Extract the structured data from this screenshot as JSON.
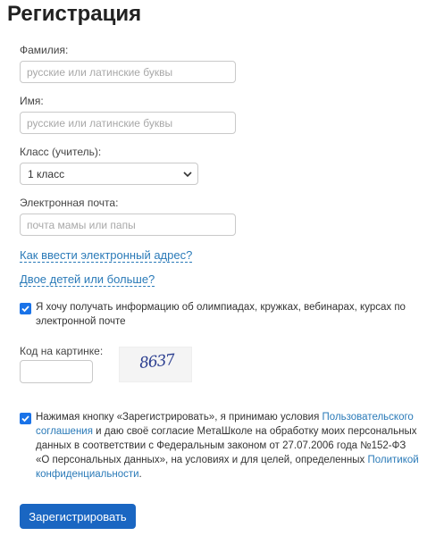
{
  "page": {
    "title": "Регистрация"
  },
  "form": {
    "surname": {
      "label": "Фамилия:",
      "value": "",
      "placeholder": "русские или латинские буквы"
    },
    "name": {
      "label": "Имя:",
      "value": "",
      "placeholder": "русские или латинские буквы"
    },
    "grade": {
      "label": "Класс (учитель):",
      "selected": "1 класс"
    },
    "email": {
      "label": "Электронная почта:",
      "value": "",
      "placeholder": "почта мамы или папы"
    },
    "links": {
      "how_to_email": "Как ввести электронный адрес?",
      "two_children": "Двое детей или больше?"
    },
    "newsletter": {
      "checked": true,
      "text": "Я хочу получать информацию об олимпиадах, кружках, вебинарах, курсах по электронной почте"
    },
    "captcha": {
      "label": "Код на картинке:",
      "image_text": "8637"
    },
    "consent": {
      "checked": true,
      "text_1": "Нажимая кнопку «Зарегистрировать», я принимаю условия ",
      "link_1": "Пользовательского соглашения",
      "text_2": " и даю своё согласие МетаШколе на обработку моих персональных данных в соответствии с Федеральным законом от 27.07.2006 года №152-ФЗ «О персональных данных», на условиях и для целей, определенных ",
      "link_2": "Политикой конфиденциальности",
      "text_3": "."
    },
    "submit_label": "Зарегистрировать"
  },
  "colors": {
    "link": "#2a7ab8",
    "checkbox": "#1a73e8",
    "button": "#1a66c2"
  },
  "icons": {
    "select_arrow": "chevron-down-icon",
    "checkmark": "checkmark-icon"
  }
}
